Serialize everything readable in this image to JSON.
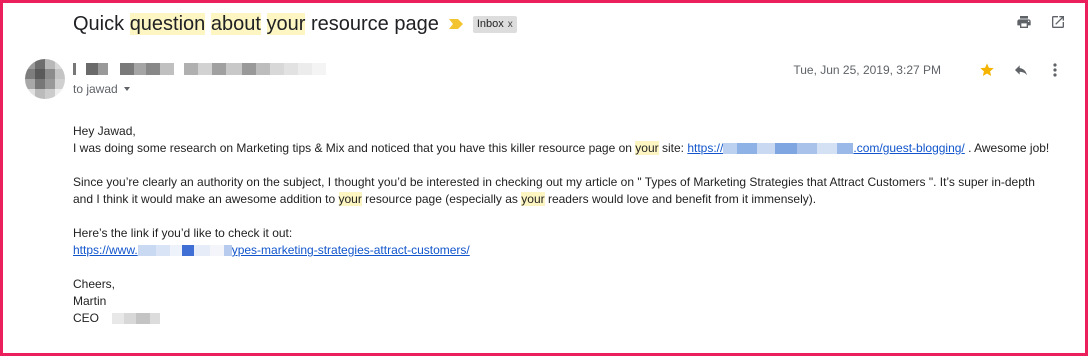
{
  "subject": {
    "parts": [
      {
        "text": "Quick ",
        "hl": false
      },
      {
        "text": "question",
        "hl": true
      },
      {
        "text": " ",
        "hl": false
      },
      {
        "text": "about",
        "hl": true
      },
      {
        "text": " ",
        "hl": false
      },
      {
        "text": "your",
        "hl": true
      },
      {
        "text": " resource page",
        "hl": false
      }
    ],
    "label_chip": "Inbox",
    "label_chip_close": "x"
  },
  "header_icons": [
    "print-icon",
    "open-in-new-window-icon"
  ],
  "sender": {
    "to_line": "to jawad"
  },
  "meta": {
    "date": "Tue, Jun 25, 2019, 3:27 PM",
    "icons": [
      "star-icon",
      "reply-icon",
      "more-vert-icon"
    ]
  },
  "body": {
    "greeting": "Hey Jawad,",
    "line1_pre": "I was doing some research on Marketing tips & Mix and noticed that you have this killer resource page on ",
    "line1_hl": "your",
    "line1_mid": " site:  ",
    "link1_prefix": "https://",
    "link1_suffix": ".com/guest-blogging/",
    "line1_post": "  . Awesome job!",
    "para2_a": "Since you’re clearly an authority on the subject, I thought you’d be interested in checking out my article on \" Types of Marketing Strategies that Attract Customers  \". It’s super in-depth",
    "para2_b_pre": "and I think it would make an awesome addition to ",
    "para2_b_hl1": "your",
    "para2_b_mid": " resource page (especially as ",
    "para2_b_hl2": "your",
    "para2_b_post": " readers would love and benefit from it immensely).",
    "para3_a": "Here’s the link if you’d like to check it out:",
    "link2_prefix": "https://www.",
    "link2_suffix": "ypes-marketing-strategies-attract-customers/",
    "signoff": "Cheers,",
    "name": "Martin",
    "title": "CEO"
  },
  "colors": {
    "frame": "#ec1f5d",
    "highlight": "#fdf6c3",
    "importance": "#f4c430",
    "star": "#f4b400",
    "link": "#1155cc"
  }
}
